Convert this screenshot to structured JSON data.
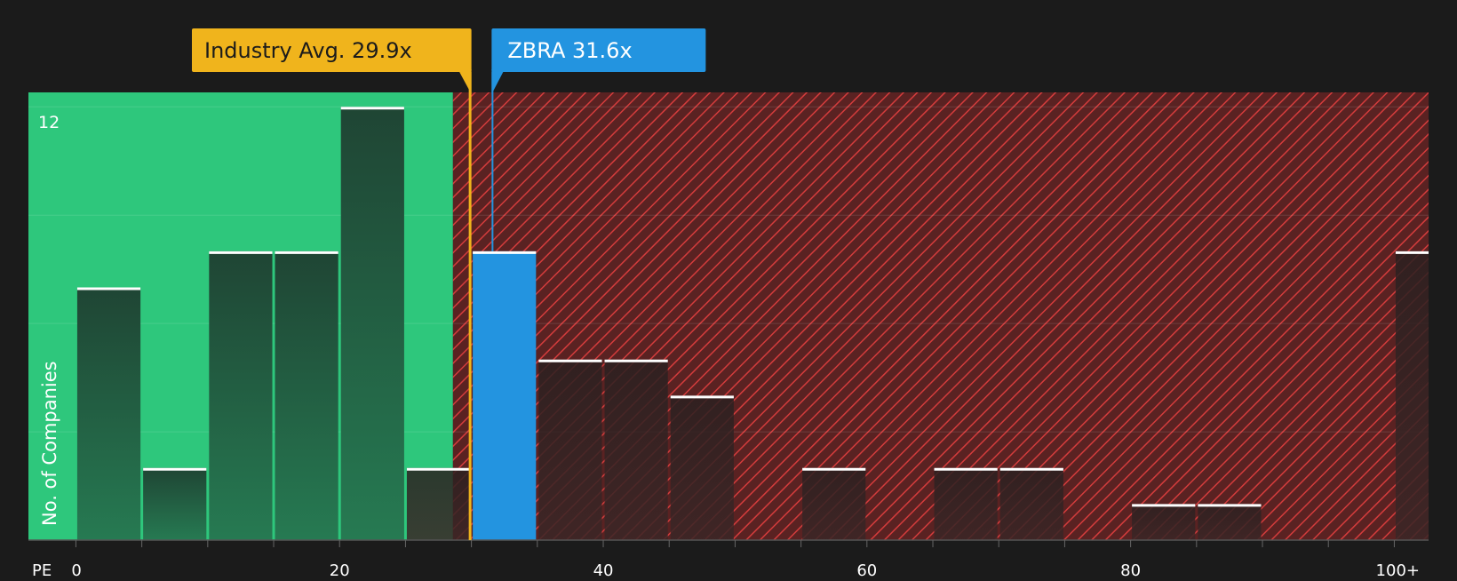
{
  "chart_data": {
    "type": "bar",
    "title": "",
    "xlabel": "PE",
    "ylabel": "No. of Companies",
    "ylim": [
      0,
      12.4
    ],
    "y_tick_labels": [
      "12"
    ],
    "x_tick_labels": [
      "0",
      "20",
      "40",
      "60",
      "80",
      "100+"
    ],
    "x_range": [
      -3.6,
      102.6
    ],
    "bin_width": 5,
    "bins": [
      {
        "x0": 0,
        "value": 7
      },
      {
        "x0": 5,
        "value": 2
      },
      {
        "x0": 10,
        "value": 8
      },
      {
        "x0": 15,
        "value": 8
      },
      {
        "x0": 20,
        "value": 12
      },
      {
        "x0": 25,
        "value": 2
      },
      {
        "x0": 30,
        "value": 8,
        "highlight": true
      },
      {
        "x0": 35,
        "value": 5
      },
      {
        "x0": 40,
        "value": 5
      },
      {
        "x0": 45,
        "value": 4
      },
      {
        "x0": 55,
        "value": 2
      },
      {
        "x0": 65,
        "value": 2
      },
      {
        "x0": 70,
        "value": 2
      },
      {
        "x0": 80,
        "value": 1
      },
      {
        "x0": 85,
        "value": 1
      },
      {
        "x0": 100,
        "value": 8
      }
    ],
    "fair_value_zone_end": 28.6,
    "markers": {
      "industry": {
        "label": "Industry Avg. 29.9x",
        "value": 29.9,
        "color": "#f0b41c"
      },
      "company": {
        "label": "ZBRA 31.6x",
        "value": 31.6,
        "color": "#2394e0"
      }
    },
    "colors": {
      "background": "#1b1b1b",
      "green_zone": "#2ec77c",
      "red_zone": "#7a2a2a",
      "hatch": "#d43c3c",
      "bar_green": "#215a3e",
      "bar_red": "#2d2222",
      "highlight_bar": "#2394e0",
      "bar_top": "#ffffff"
    }
  }
}
